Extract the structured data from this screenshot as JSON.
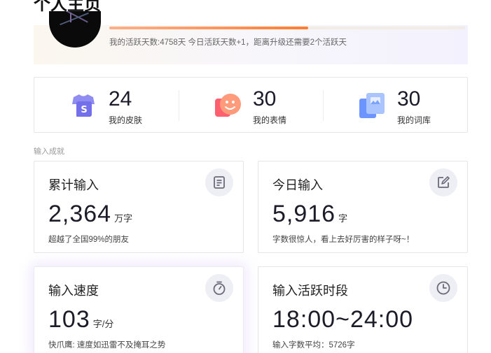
{
  "page": {
    "title": "个人主页"
  },
  "profile": {
    "active_text": "我的活跃天数:4758天 今日活跃天数+1，距离升级还需要2个活跃天",
    "progress_fraction": 0.56
  },
  "stats": [
    {
      "value": "24",
      "label": "我的皮肤",
      "icon": "skin-icon"
    },
    {
      "value": "30",
      "label": "我的表情",
      "icon": "emoji-icon"
    },
    {
      "value": "30",
      "label": "我的词库",
      "icon": "lexicon-icon"
    }
  ],
  "achievements": {
    "section_label": "输入成就",
    "cards": [
      {
        "title": "累计输入",
        "value": "2,364",
        "unit": "万字",
        "note": "超越了全国99%的朋友",
        "icon": "document-icon"
      },
      {
        "title": "今日输入",
        "value": "5,916",
        "unit": "字",
        "note": "字数很惊人，看上去好厉害的样子呀~！",
        "icon": "edit-icon"
      },
      {
        "title": "输入速度",
        "value": "103",
        "unit": "字/分",
        "note": "快爪鹰: 速度如迅雷不及掩耳之势",
        "icon": "stopwatch-icon"
      },
      {
        "title": "输入活跃时段",
        "value": "18:00~24:00",
        "unit": "",
        "note": "输入字数平均：5726字",
        "icon": "clock-icon"
      }
    ]
  },
  "colors": {
    "progress": "#ff7d2e",
    "skin": "#7e7cf0",
    "emoji": "#ff7a6a",
    "lexicon": "#6fa0ff",
    "card_icon_bg": "#eeeef5",
    "card_icon_stroke": "#6b6b78"
  }
}
